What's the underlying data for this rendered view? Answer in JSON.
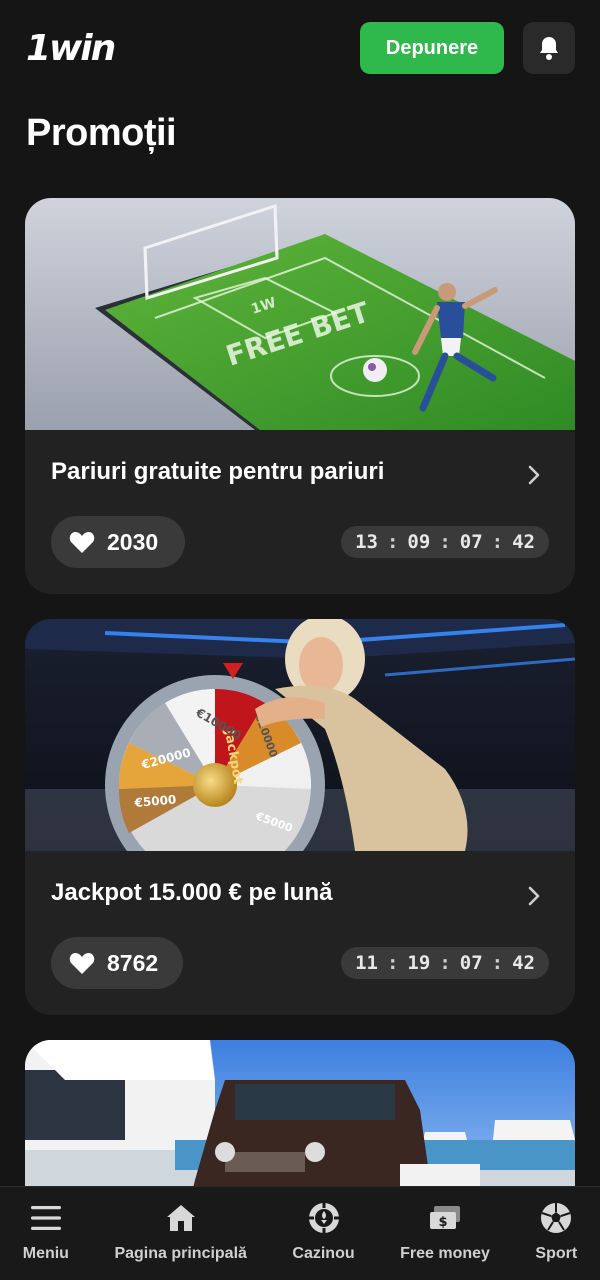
{
  "header": {
    "logo_text": "1win",
    "deposit_label": "Depunere",
    "bell_icon": "bell-icon"
  },
  "page": {
    "title": "Promoții"
  },
  "promos": [
    {
      "title": "Pariuri gratuite pentru pariuri",
      "likes": "2030",
      "timer": {
        "d": "13",
        "h": "09",
        "m": "07",
        "s": "42"
      },
      "image_text": "FREE BET",
      "image_logo": "1W"
    },
    {
      "title": "Jackpot 15.000 € pe lună",
      "likes": "8762",
      "timer": {
        "d": "11",
        "h": "19",
        "m": "07",
        "s": "42"
      },
      "image_text": "Jackpot",
      "wheel_labels": [
        "€10000",
        "€20000",
        "€5000",
        "€10000",
        "€5000"
      ]
    }
  ],
  "timer_separator": ":",
  "bottom_nav": [
    {
      "label": "Meniu",
      "icon": "menu-icon"
    },
    {
      "label": "Pagina principală",
      "icon": "home-icon"
    },
    {
      "label": "Cazinou",
      "icon": "casino-chip-icon"
    },
    {
      "label": "Free money",
      "icon": "money-icon"
    },
    {
      "label": "Sport",
      "icon": "soccer-ball-icon"
    }
  ],
  "colors": {
    "background": "#151515",
    "card": "#222222",
    "accent_green": "#2fb84c",
    "pill": "#3a3a3a"
  }
}
